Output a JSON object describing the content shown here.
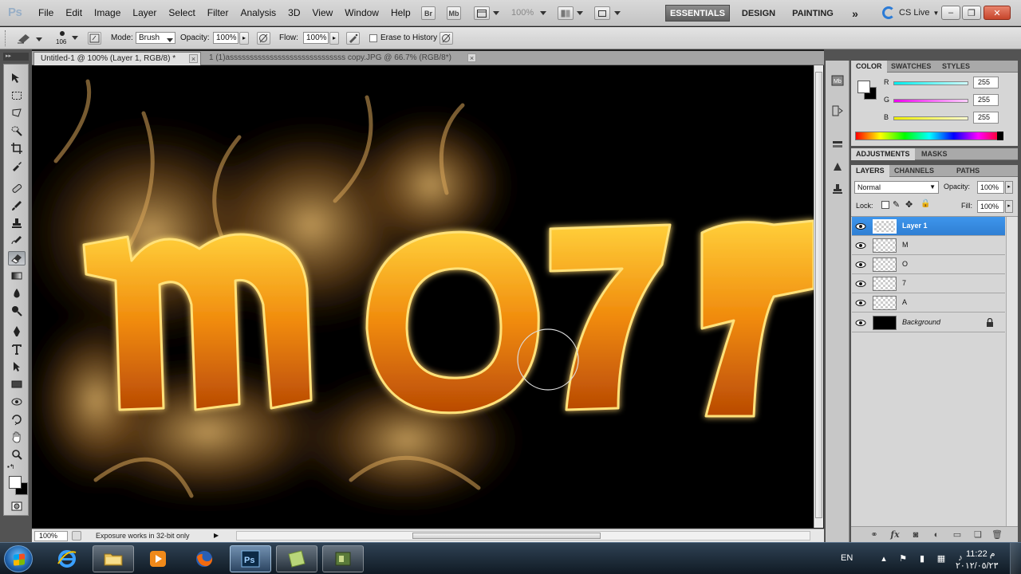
{
  "app": {
    "logo": "Ps",
    "menu": [
      "File",
      "Edit",
      "Image",
      "Layer",
      "Select",
      "Filter",
      "Analysis",
      "3D",
      "View",
      "Window",
      "Help"
    ],
    "bridge_label": "Br",
    "minibridge_label": "Mb",
    "zoom": "100%",
    "workspaces": [
      "ESSENTIALS",
      "DESIGN",
      "PAINTING"
    ],
    "more": "»",
    "cs_live": "CS Live",
    "window_controls": {
      "minimize": "–",
      "restore": "❐",
      "close": "✕"
    }
  },
  "options": {
    "brush_size": "106",
    "mode_label": "Mode:",
    "mode_value": "Brush",
    "opacity_label": "Opacity:",
    "opacity_value": "100%",
    "flow_label": "Flow:",
    "flow_value": "100%",
    "erase_history_label": "Erase to History"
  },
  "documents": {
    "tabs": [
      {
        "label": "Untitled-1 @ 100% (Layer 1, RGB/8) *",
        "close": "×"
      },
      {
        "label": "1 (1)asssssssssssssssssssssssssssss copy.JPG @ 66.7% (RGB/8*)",
        "close": "×"
      }
    ],
    "canvas_text": [
      "m",
      "o",
      "7",
      "A"
    ]
  },
  "status": {
    "zoom": "100%",
    "message": "Exposure works in 32-bit only"
  },
  "color_panel": {
    "tabs": [
      "COLOR",
      "SWATCHES",
      "STYLES"
    ],
    "channels": [
      {
        "label": "R",
        "value": "255",
        "color": "#00cccc"
      },
      {
        "label": "G",
        "value": "255",
        "color": "#cc00cc"
      },
      {
        "label": "B",
        "value": "255",
        "color": "#cccc00"
      }
    ]
  },
  "adjustments_panel": {
    "tabs": [
      "ADJUSTMENTS",
      "MASKS"
    ]
  },
  "layers_panel": {
    "tabs": [
      "LAYERS",
      "CHANNELS",
      "PATHS"
    ],
    "blend_mode": "Normal",
    "opacity_label": "Opacity:",
    "opacity_value": "100%",
    "lock_label": "Lock:",
    "fill_label": "Fill:",
    "fill_value": "100%",
    "layers": [
      {
        "name": "Layer 1",
        "selected": true
      },
      {
        "name": "M",
        "selected": false
      },
      {
        "name": "O",
        "selected": false
      },
      {
        "name": "7",
        "selected": false
      },
      {
        "name": "A",
        "selected": false
      },
      {
        "name": "Background",
        "selected": false,
        "locked": true
      }
    ],
    "footer_icons": [
      "link-icon",
      "fx-icon",
      "mask-icon",
      "adjustment-icon",
      "group-icon",
      "new-layer-icon",
      "trash-icon"
    ]
  },
  "taskbar": {
    "language": "EN",
    "time": "11:22 م",
    "date": "٢٠١٢/٠٥/٢٣",
    "apps": [
      "internet-explorer",
      "file-explorer",
      "media-player",
      "firefox",
      "photoshop",
      "notes",
      "program"
    ]
  }
}
